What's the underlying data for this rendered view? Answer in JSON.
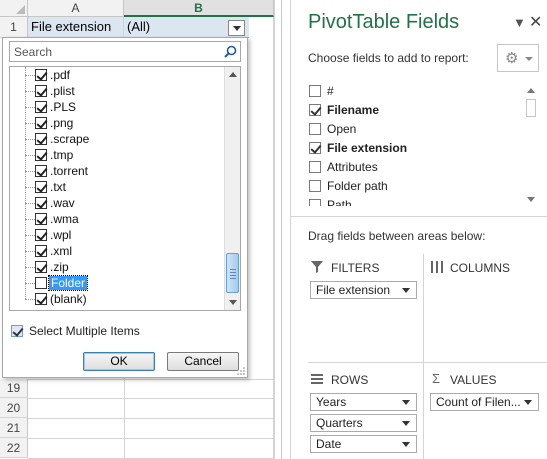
{
  "sheet": {
    "columns": [
      "A",
      "B"
    ],
    "header_row": "1",
    "cell_a1": "File extension",
    "cell_b1": "(All)",
    "rows_visible": [
      "19",
      "20",
      "21",
      "22"
    ]
  },
  "filter": {
    "search_placeholder": "Search",
    "items": [
      {
        "label": ".pdf",
        "checked": true
      },
      {
        "label": ".plist",
        "checked": true
      },
      {
        "label": ".PLS",
        "checked": true
      },
      {
        "label": ".png",
        "checked": true
      },
      {
        "label": ".scrape",
        "checked": true
      },
      {
        "label": ".tmp",
        "checked": true
      },
      {
        "label": ".torrent",
        "checked": true
      },
      {
        "label": ".txt",
        "checked": true
      },
      {
        "label": ".wav",
        "checked": true
      },
      {
        "label": ".wma",
        "checked": true
      },
      {
        "label": ".wpl",
        "checked": true
      },
      {
        "label": ".xml",
        "checked": true
      },
      {
        "label": ".zip",
        "checked": true
      },
      {
        "label": "Folder",
        "checked": false,
        "selected": true
      },
      {
        "label": "(blank)",
        "checked": true
      }
    ],
    "select_multiple_label": "Select Multiple Items",
    "select_multiple_checked": true,
    "ok_label": "OK",
    "cancel_label": "Cancel"
  },
  "pivot": {
    "title": "PivotTable Fields",
    "choose_label": "Choose fields to add to report:",
    "fields": [
      {
        "label": "#",
        "checked": false,
        "bold": false
      },
      {
        "label": "Filename",
        "checked": true,
        "bold": true
      },
      {
        "label": "Open",
        "checked": false,
        "bold": false
      },
      {
        "label": "File extension",
        "checked": true,
        "bold": true
      },
      {
        "label": "Attributes",
        "checked": false,
        "bold": false
      },
      {
        "label": "Folder path",
        "checked": false,
        "bold": false
      },
      {
        "label": "Path",
        "checked": false,
        "bold": false
      }
    ],
    "drag_label": "Drag fields between areas below:",
    "areas": {
      "filters_title": "FILTERS",
      "columns_title": "COLUMNS",
      "rows_title": "ROWS",
      "values_title": "VALUES",
      "filters_items": [
        "File extension"
      ],
      "rows_items": [
        "Years",
        "Quarters",
        "Date"
      ],
      "values_items": [
        "Count of Filen..."
      ]
    },
    "accent_color": "#217346"
  },
  "icons": {
    "search": "search-icon",
    "gear": "gear-icon",
    "close": "close-icon",
    "filter": "filter-icon",
    "columns": "columns-icon",
    "rows": "rows-icon",
    "sigma": "sigma-icon"
  }
}
